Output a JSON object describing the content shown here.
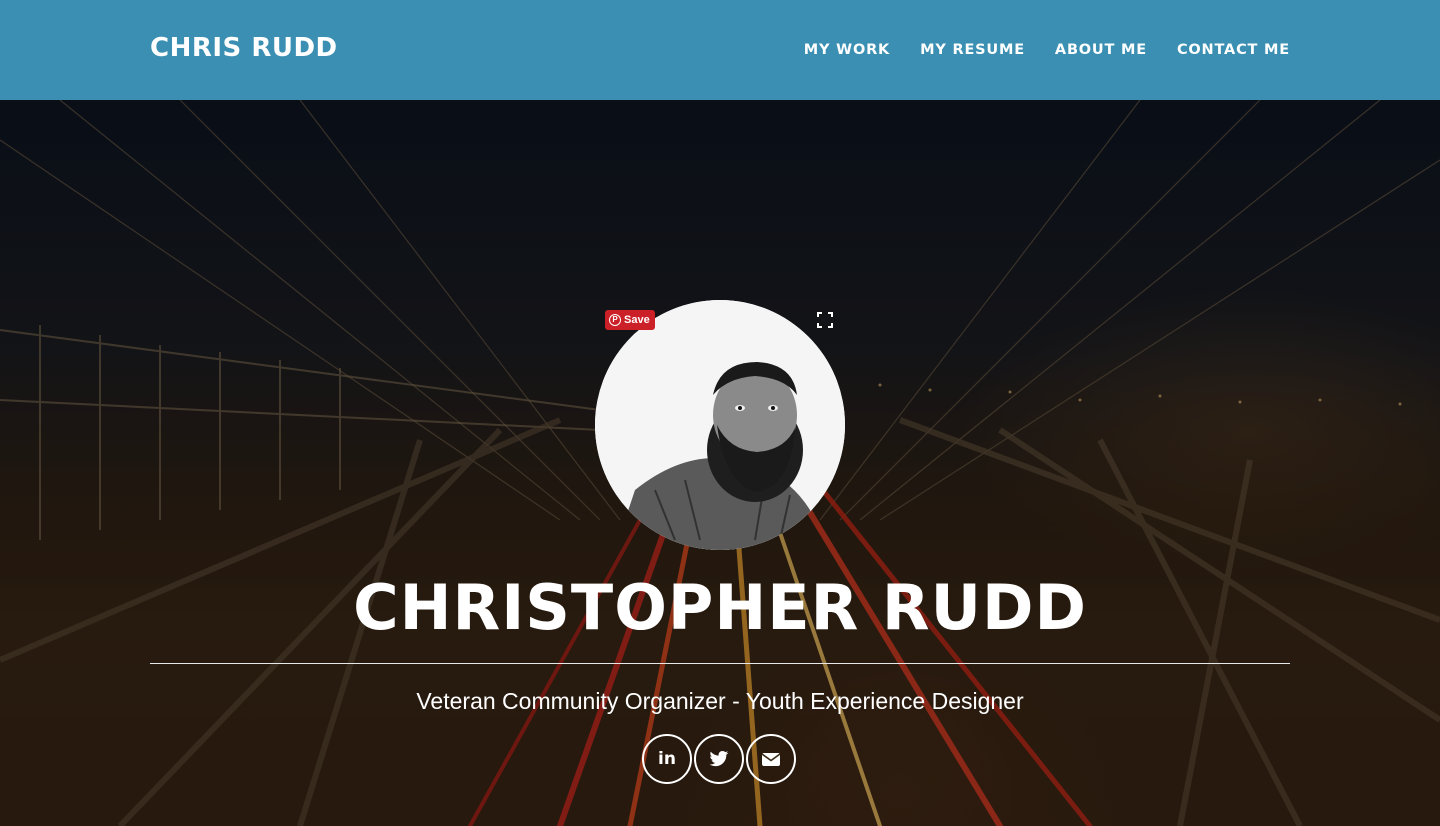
{
  "nav": {
    "brand": "CHRIS RUDD",
    "links": [
      "MY WORK",
      "MY RESUME",
      "ABOUT ME",
      "CONTACT ME"
    ]
  },
  "hero": {
    "pin_save_label": "Save",
    "title": "CHRISTOPHER RUDD",
    "tagline": "Veteran Community Organizer - Youth Experience Designer",
    "social": [
      {
        "icon": "linkedin-icon",
        "glyph": "in"
      },
      {
        "icon": "twitter-icon",
        "glyph": ""
      },
      {
        "icon": "envelope-icon",
        "glyph": ""
      }
    ]
  },
  "colors": {
    "nav_bg": "#3a8fb3",
    "pinterest_red": "#cb2027",
    "text": "#ffffff"
  }
}
